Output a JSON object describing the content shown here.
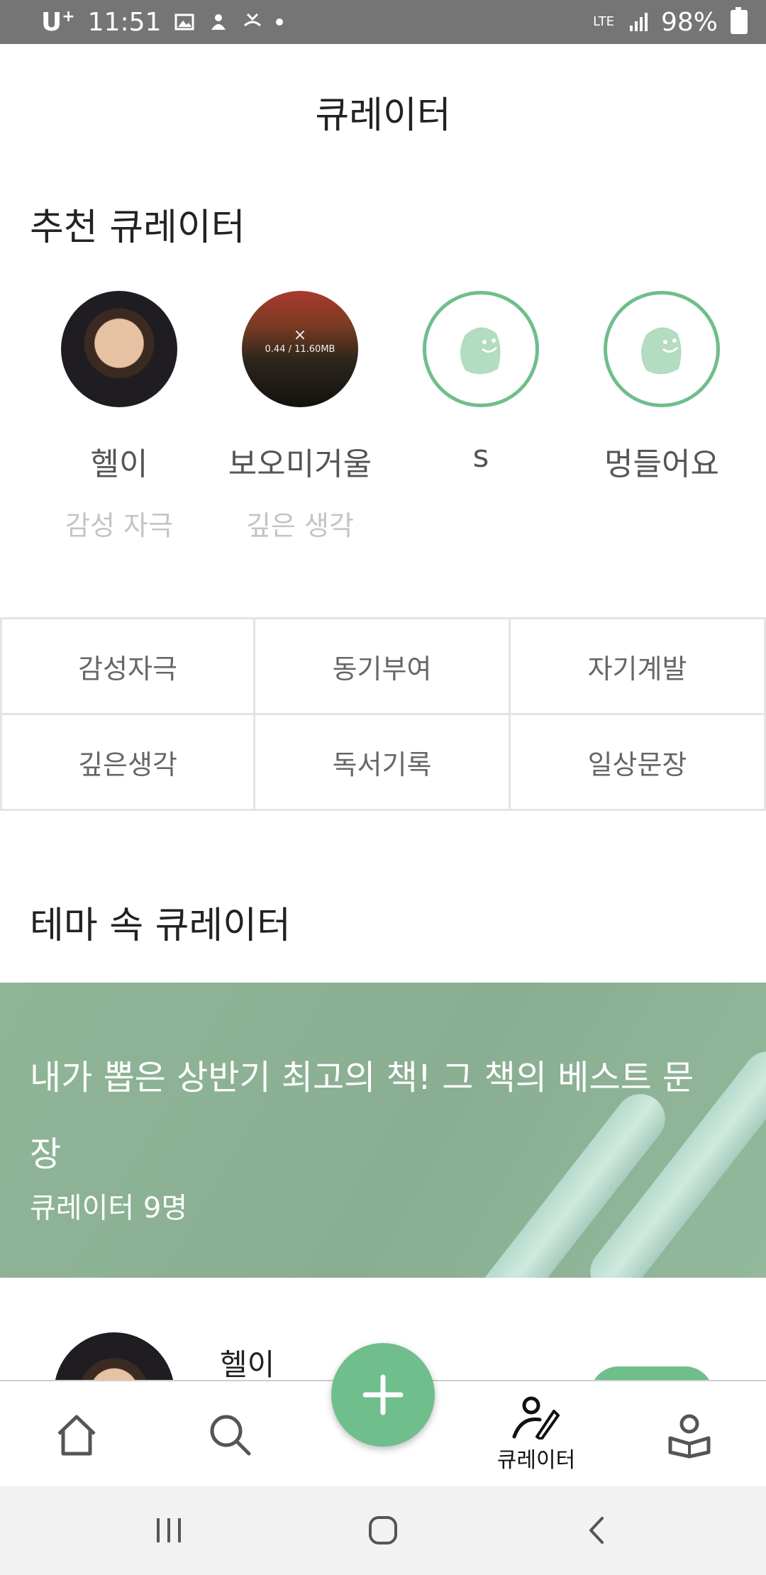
{
  "status_bar": {
    "carrier": "U",
    "carrier_sup": "+",
    "time": "11:51",
    "network": "LTE",
    "battery": "98%"
  },
  "header": {
    "title": "큐레이터"
  },
  "recommended": {
    "heading": "추천 큐레이터",
    "curators": [
      {
        "name": "헬이",
        "tag": "감성 자극",
        "avatar": "photo"
      },
      {
        "name": "보오미거울",
        "tag": "깊은 생각",
        "avatar": "photo",
        "overlay": "0.44 / 11.60MB"
      },
      {
        "name": "s",
        "tag": "",
        "avatar": "default-mascot"
      },
      {
        "name": "멍들어요",
        "tag": "",
        "avatar": "default-mascot"
      }
    ]
  },
  "categories": [
    "감성자극",
    "동기부여",
    "자기계발",
    "깊은생각",
    "독서기록",
    "일상문장"
  ],
  "theme": {
    "heading": "테마 속 큐레이터",
    "banner_title": "내가 뽑은 상반기 최고의 책! 그 책의 베스트 문장",
    "banner_sub": "큐레이터 9명"
  },
  "list_preview": {
    "name": "헬이"
  },
  "bottom_nav": {
    "items": [
      {
        "icon": "home-icon",
        "label": ""
      },
      {
        "icon": "search-icon",
        "label": ""
      },
      {
        "icon": "add-icon",
        "label": ""
      },
      {
        "icon": "curator-icon",
        "label": "큐레이터",
        "active": true
      },
      {
        "icon": "library-profile-icon",
        "label": ""
      }
    ]
  },
  "colors": {
    "accent": "#6fbe8b",
    "banner": "#8fb597",
    "statusbar": "#757575"
  }
}
